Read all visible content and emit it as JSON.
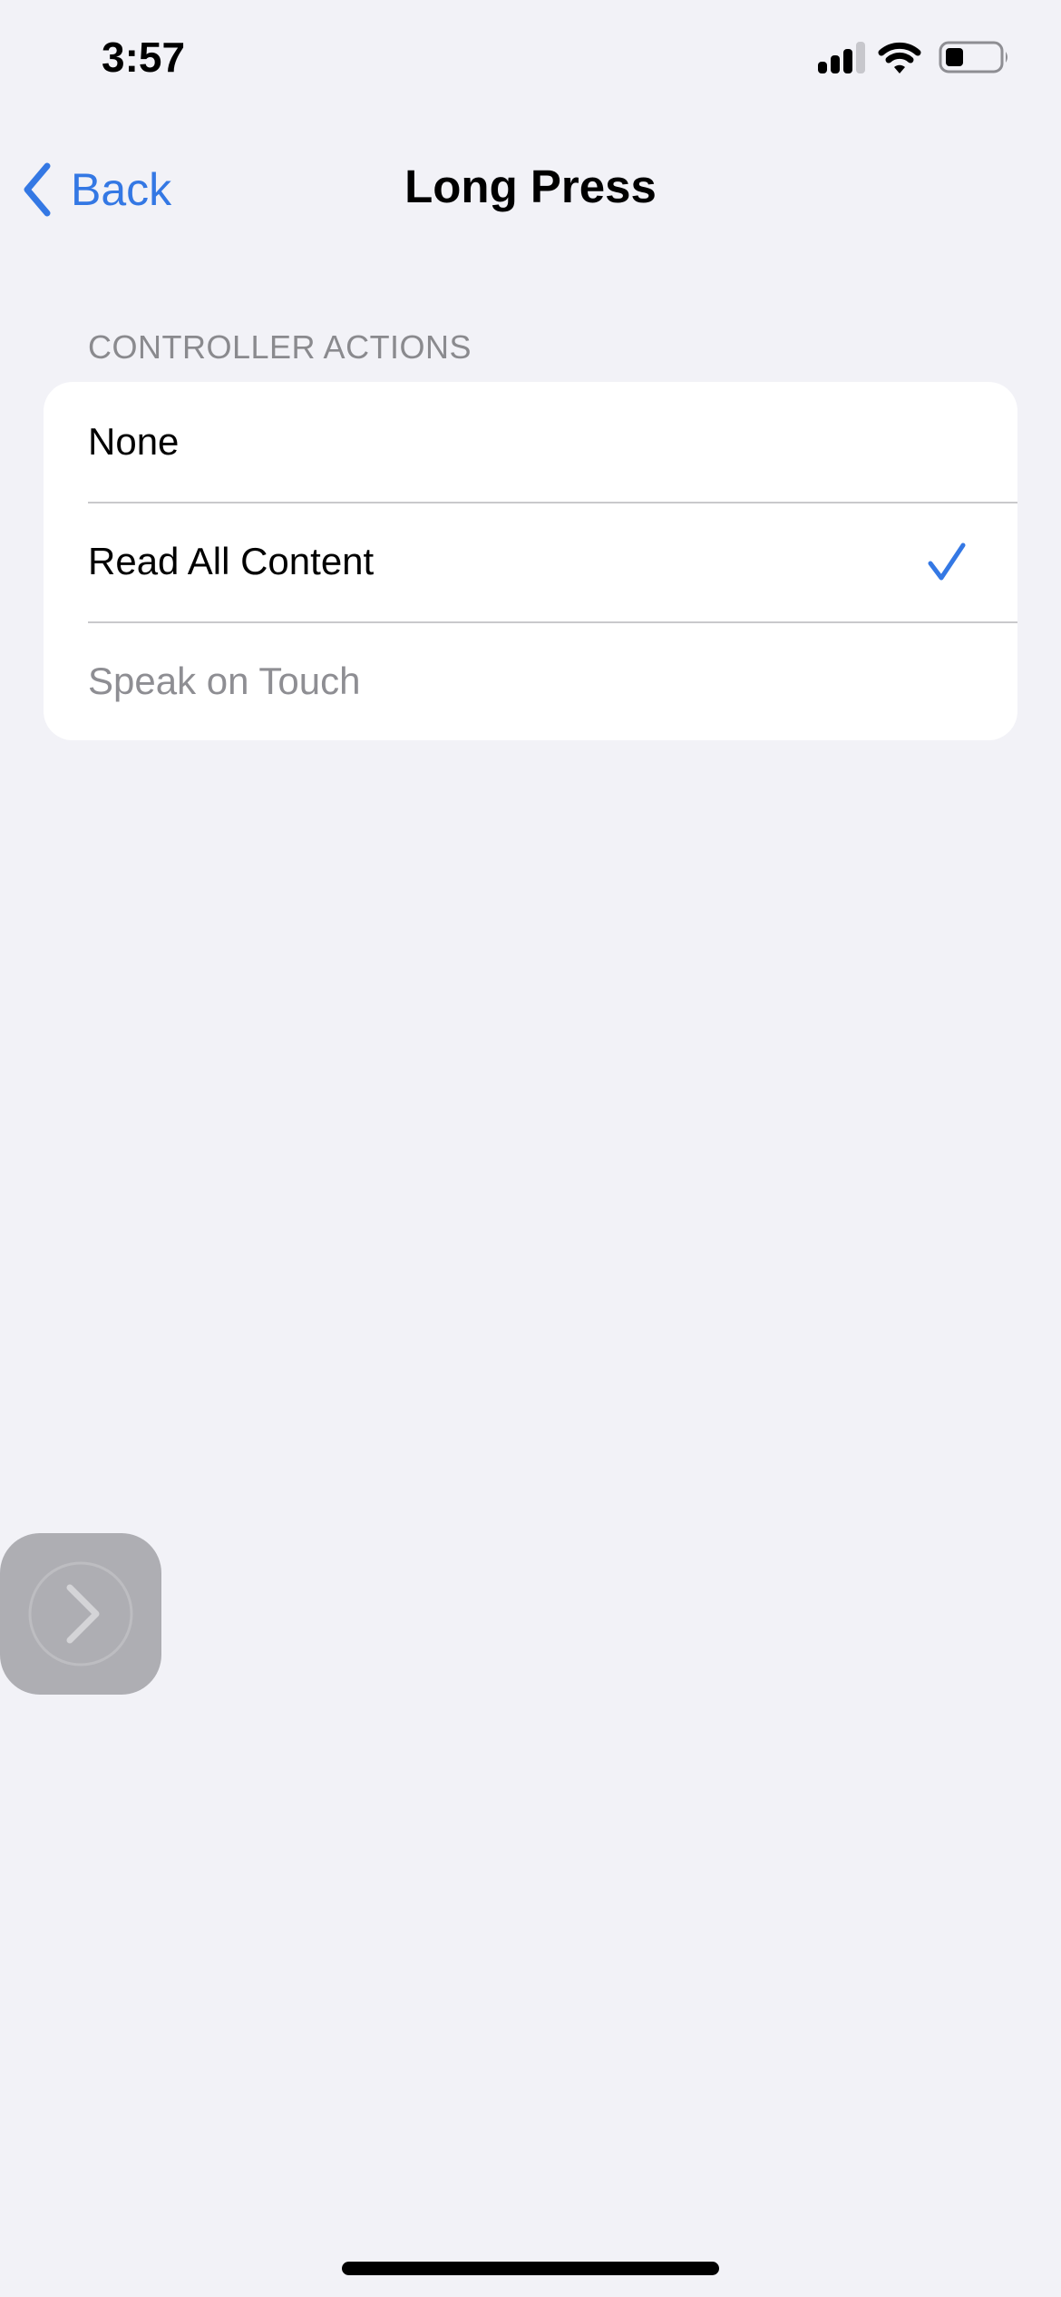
{
  "status_bar": {
    "time": "3:57",
    "signal_icon": "cellular-signal-icon",
    "signal_bars_active": 3,
    "signal_bars_total": 4,
    "wifi_icon": "wifi-icon",
    "battery_icon": "battery-icon",
    "battery_level": 0.25
  },
  "nav": {
    "back_label": "Back",
    "back_icon": "chevron-left-icon",
    "title": "Long Press"
  },
  "section": {
    "header": "CONTROLLER ACTIONS",
    "items": [
      {
        "label": "None",
        "selected": false,
        "enabled": true
      },
      {
        "label": "Read All Content",
        "selected": true,
        "enabled": true
      },
      {
        "label": "Speak on Touch",
        "selected": false,
        "enabled": false
      }
    ],
    "checkmark_icon": "checkmark-icon"
  },
  "colors": {
    "accent": "#3478e4",
    "background": "#f2f2f7",
    "secondary_text": "#8a8a8e",
    "disabled_text": "#8e8e93"
  },
  "assistive_touch": {
    "icon": "chevron-right-circle-icon"
  }
}
